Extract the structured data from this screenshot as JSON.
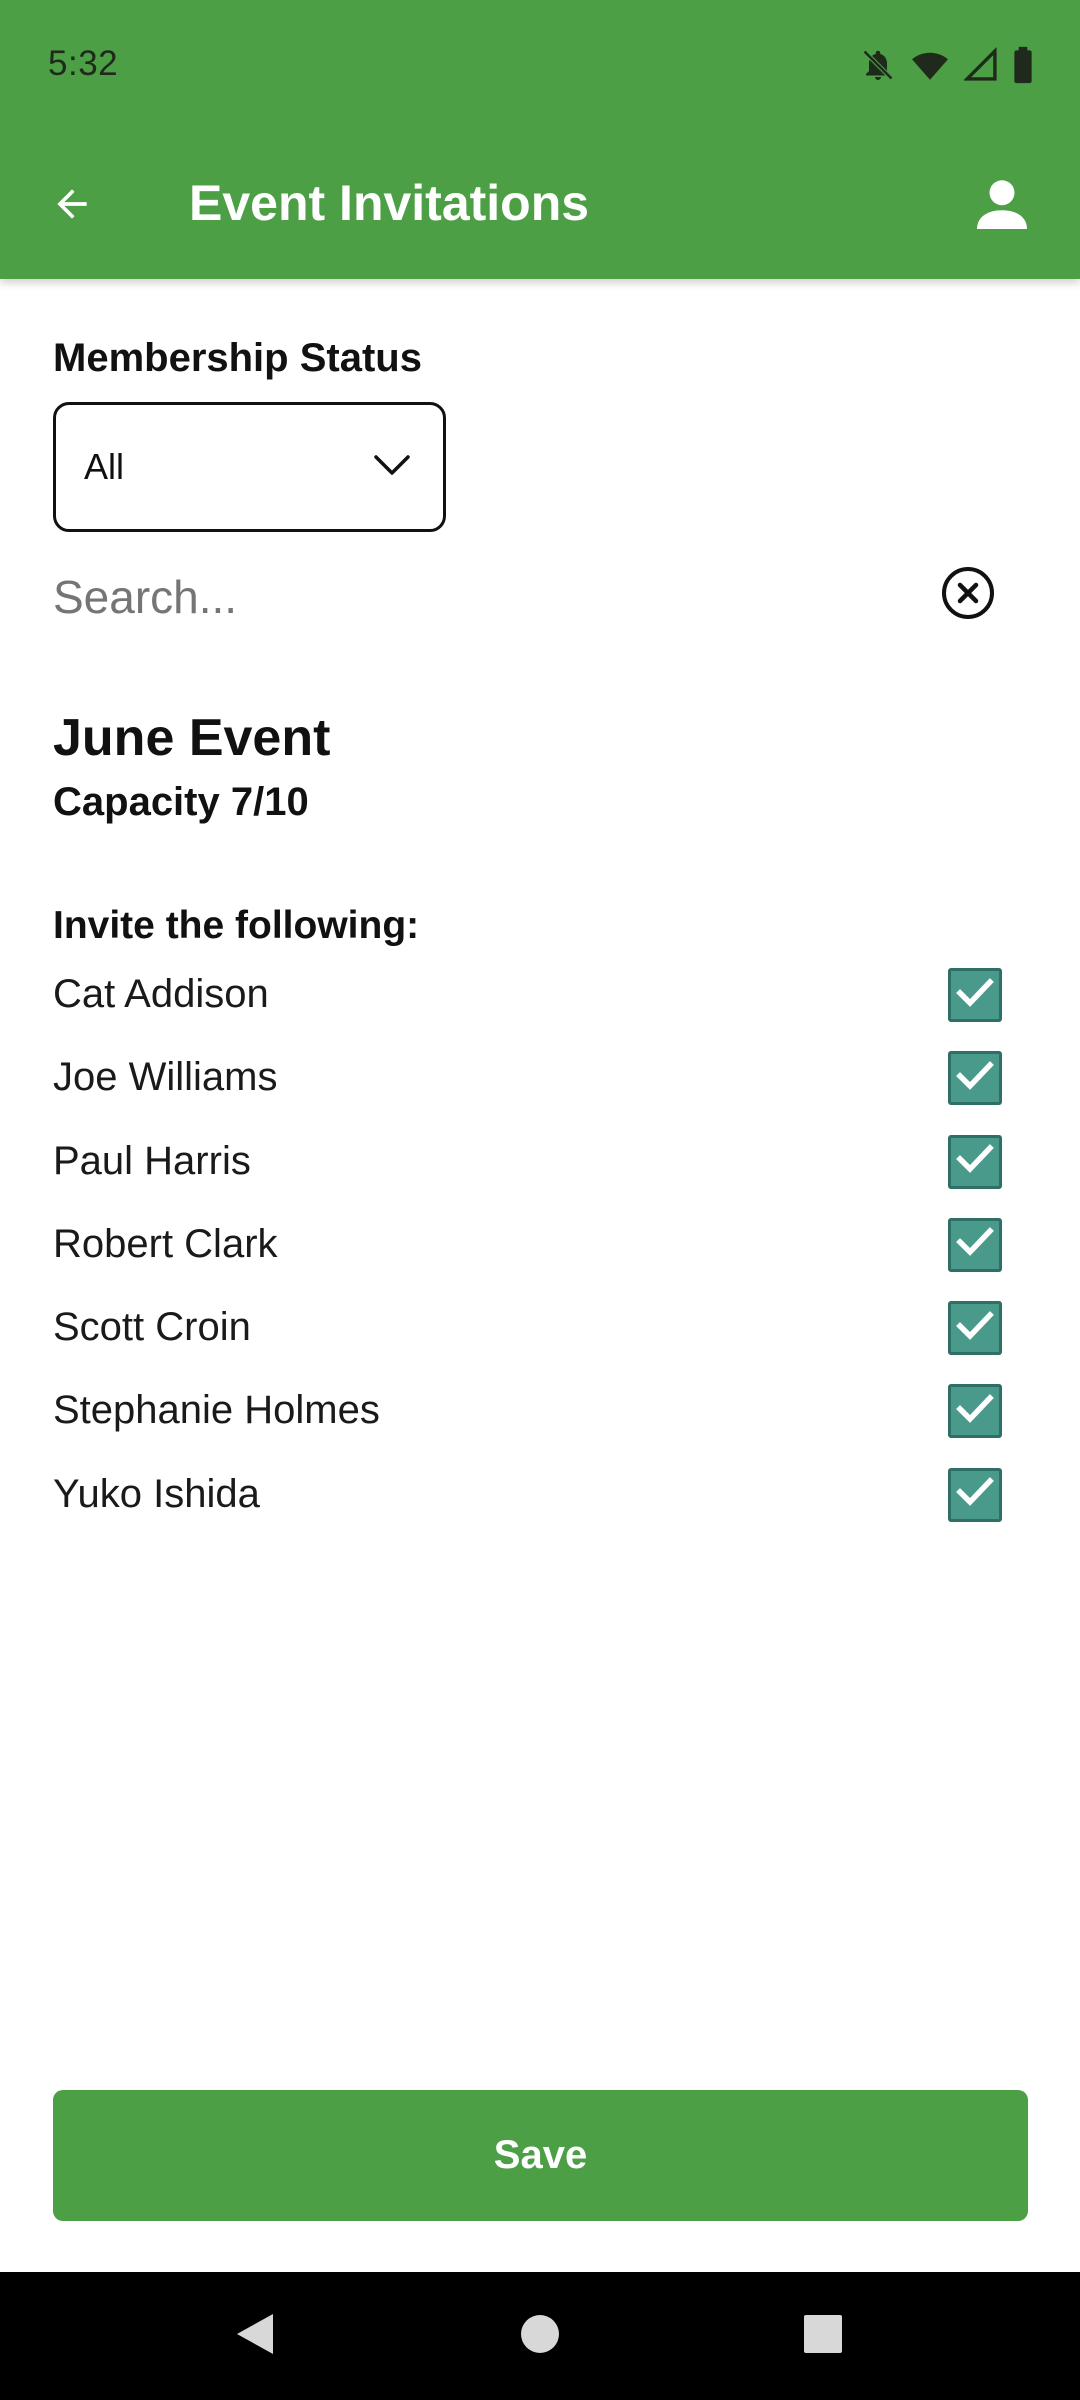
{
  "status_bar": {
    "time": "5:32",
    "icons": [
      "notifications-off-icon",
      "wifi-icon",
      "signal-icon",
      "battery-icon"
    ]
  },
  "app_bar": {
    "title": "Event Invitations",
    "back_icon": "arrow-left-icon",
    "profile_icon": "person-icon"
  },
  "filters": {
    "membership_label": "Membership Status",
    "membership_selected": "All",
    "search_placeholder": "Search...",
    "search_value": ""
  },
  "event": {
    "title": "June Event",
    "capacity": "Capacity 7/10"
  },
  "invites": {
    "label": "Invite the following:",
    "people": [
      {
        "name": "Cat Addison",
        "checked": true
      },
      {
        "name": "Joe Williams",
        "checked": true
      },
      {
        "name": "Paul Harris",
        "checked": true
      },
      {
        "name": "Robert Clark",
        "checked": true
      },
      {
        "name": "Scott Croin",
        "checked": true
      },
      {
        "name": "Stephanie Holmes",
        "checked": true
      },
      {
        "name": "Yuko Ishida",
        "checked": true
      }
    ]
  },
  "actions": {
    "save_label": "Save"
  },
  "colors": {
    "primary": "#4c9f44",
    "checkbox": "#4a9a8c",
    "nav_bar": "#000000"
  },
  "nav": {
    "icons": [
      "back-triangle-icon",
      "home-circle-icon",
      "recents-square-icon"
    ]
  }
}
